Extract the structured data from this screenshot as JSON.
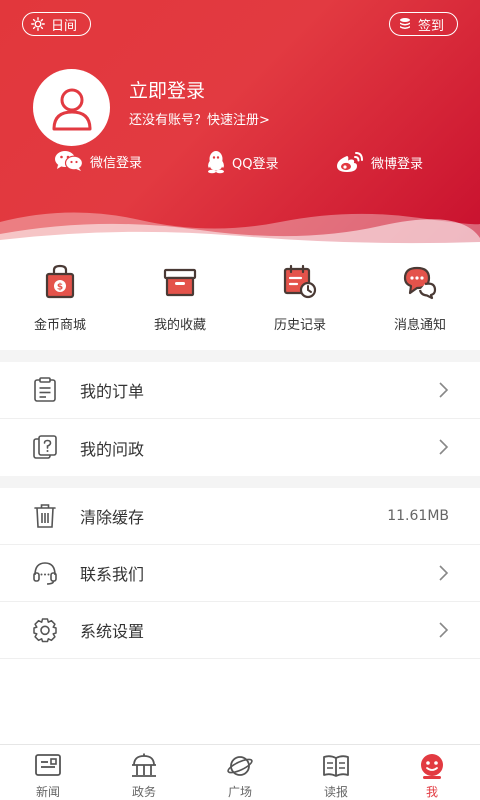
{
  "header": {
    "day_mode_label": "日间",
    "sign_in_label": "签到",
    "login_title": "立即登录",
    "register_prompt": "还没有账号？快速注册>",
    "social": [
      {
        "label": "微信登录",
        "icon": "wechat-icon"
      },
      {
        "label": "QQ登录",
        "icon": "qq-icon"
      },
      {
        "label": "微博登录",
        "icon": "weibo-icon"
      }
    ]
  },
  "quick": [
    {
      "label": "金币商城",
      "icon": "coin-bag-icon"
    },
    {
      "label": "我的收藏",
      "icon": "favorite-box-icon"
    },
    {
      "label": "历史记录",
      "icon": "history-calendar-icon"
    },
    {
      "label": "消息通知",
      "icon": "message-bubble-icon"
    }
  ],
  "menu": {
    "orders": {
      "label": "我的订单",
      "icon": "order-list-icon"
    },
    "politics": {
      "label": "我的问政",
      "icon": "question-doc-icon"
    },
    "cache": {
      "label": "清除缓存",
      "value": "11.61MB",
      "icon": "trash-icon"
    },
    "contact": {
      "label": "联系我们",
      "icon": "headset-icon"
    },
    "settings": {
      "label": "系统设置",
      "icon": "gear-icon"
    }
  },
  "tabs": [
    {
      "label": "新闻",
      "icon": "news-icon",
      "active": false
    },
    {
      "label": "政务",
      "icon": "government-icon",
      "active": false
    },
    {
      "label": "广场",
      "icon": "planet-icon",
      "active": false
    },
    {
      "label": "读报",
      "icon": "book-icon",
      "active": false
    },
    {
      "label": "我",
      "icon": "profile-face-icon",
      "active": true
    }
  ],
  "colors": {
    "accent": "#e23a41",
    "accent_dark": "#c8102e",
    "icon_brown": "#4a3a35"
  }
}
